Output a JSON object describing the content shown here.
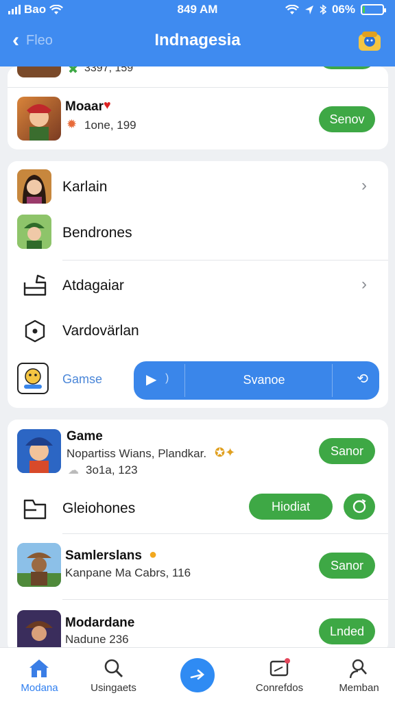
{
  "status_bar": {
    "carrier": "Bao",
    "time": "849 AM",
    "battery": "06%",
    "battery_level": 0.06
  },
  "header": {
    "back_label": "Fleo",
    "title": "Indnagesia"
  },
  "top_card": {
    "partial_row": {
      "sub": "3397, 159"
    },
    "app": {
      "name": "Moaar",
      "sub": "1one, 199",
      "button": "Senov"
    }
  },
  "menu_card": {
    "items": [
      {
        "label": "Karlain"
      },
      {
        "label": "Bendrones"
      },
      {
        "label": "Atdagaiar"
      },
      {
        "label": "Vardovärlan"
      }
    ],
    "game_row": {
      "label": "Gamse",
      "bar_label": "Svanoe"
    }
  },
  "list_card": {
    "game": {
      "name": "Game",
      "desc": "Nopartiss Wians, Plandkar.",
      "sub": "3o1a, 123",
      "button": "Sanor"
    },
    "gleiohones": {
      "label": "Gleiohones",
      "button": "Hiodiat"
    },
    "samlerslans": {
      "name": "Samlerslans",
      "desc": "Kanpane Ma Cabrs, 116",
      "button": "Sanor"
    },
    "modardane": {
      "name": "Modardane",
      "sub": "Nadune 236",
      "button": "Lnded"
    }
  },
  "tabbar": {
    "tabs": [
      {
        "label": "Modana",
        "icon": "home-icon",
        "active": true
      },
      {
        "label": "Usingaets",
        "icon": "search-icon"
      },
      {
        "label": "Conrefdos",
        "icon": "message-icon"
      },
      {
        "label": "Memban",
        "icon": "person-icon"
      }
    ]
  },
  "colors": {
    "primary": "#3f8bf0",
    "green": "#3ea845",
    "fab": "#2f8bf3",
    "background": "#eef0f3"
  }
}
